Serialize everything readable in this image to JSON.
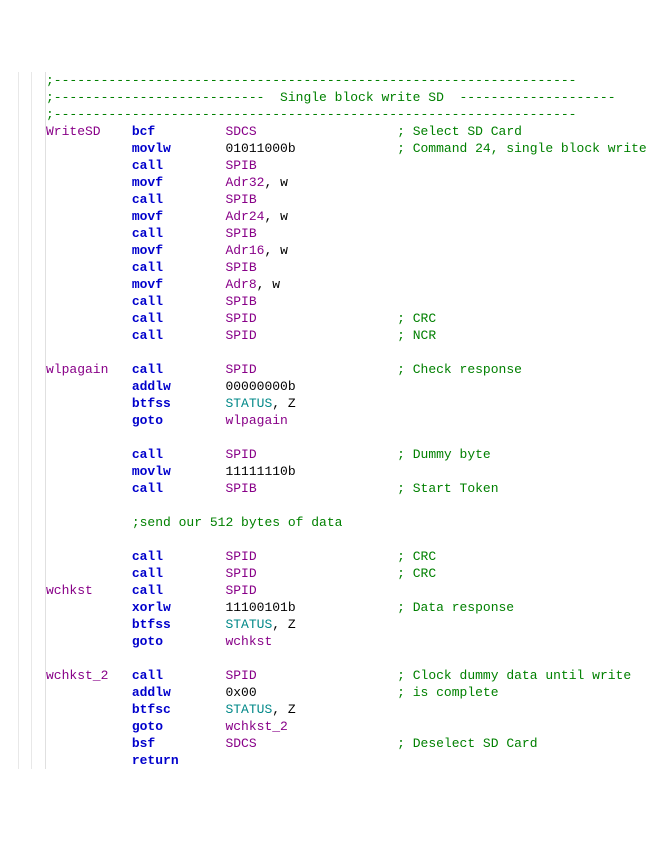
{
  "header": {
    "dashLine": ";-------------------------------------------------------------------",
    "titlePrefix": ";---------------------------  ",
    "title": "Single block write SD",
    "titleSuffix": "  --------------------"
  },
  "columns": {
    "labelWidth": 11,
    "instrWidth": 12,
    "operandWidth": 22
  },
  "lines": [
    {
      "type": "header-dash"
    },
    {
      "type": "header-title"
    },
    {
      "type": "header-dash"
    },
    {
      "type": "code",
      "label": "WriteSD",
      "instr": "bcf",
      "operands": [
        {
          "t": "operand",
          "v": "SDCS"
        }
      ],
      "comment": "; Select SD Card"
    },
    {
      "type": "code",
      "label": "",
      "instr": "movlw",
      "operands": [
        {
          "t": "text",
          "v": "01011000b"
        }
      ],
      "comment": "; Command 24, single block write"
    },
    {
      "type": "code",
      "label": "",
      "instr": "call",
      "operands": [
        {
          "t": "operand",
          "v": "SPIB"
        }
      ],
      "comment": ""
    },
    {
      "type": "code",
      "label": "",
      "instr": "movf",
      "operands": [
        {
          "t": "operand",
          "v": "Adr32"
        },
        {
          "t": "punct",
          "v": ", "
        },
        {
          "t": "text",
          "v": "w"
        }
      ],
      "comment": ""
    },
    {
      "type": "code",
      "label": "",
      "instr": "call",
      "operands": [
        {
          "t": "operand",
          "v": "SPIB"
        }
      ],
      "comment": ""
    },
    {
      "type": "code",
      "label": "",
      "instr": "movf",
      "operands": [
        {
          "t": "operand",
          "v": "Adr24"
        },
        {
          "t": "punct",
          "v": ", "
        },
        {
          "t": "text",
          "v": "w"
        }
      ],
      "comment": ""
    },
    {
      "type": "code",
      "label": "",
      "instr": "call",
      "operands": [
        {
          "t": "operand",
          "v": "SPIB"
        }
      ],
      "comment": ""
    },
    {
      "type": "code",
      "label": "",
      "instr": "movf",
      "operands": [
        {
          "t": "operand",
          "v": "Adr16"
        },
        {
          "t": "punct",
          "v": ", "
        },
        {
          "t": "text",
          "v": "w"
        }
      ],
      "comment": ""
    },
    {
      "type": "code",
      "label": "",
      "instr": "call",
      "operands": [
        {
          "t": "operand",
          "v": "SPIB"
        }
      ],
      "comment": ""
    },
    {
      "type": "code",
      "label": "",
      "instr": "movf",
      "operands": [
        {
          "t": "operand",
          "v": "Adr8"
        },
        {
          "t": "punct",
          "v": ", "
        },
        {
          "t": "text",
          "v": "w"
        }
      ],
      "comment": ""
    },
    {
      "type": "code",
      "label": "",
      "instr": "call",
      "operands": [
        {
          "t": "operand",
          "v": "SPIB"
        }
      ],
      "comment": ""
    },
    {
      "type": "code",
      "label": "",
      "instr": "call",
      "operands": [
        {
          "t": "operand",
          "v": "SPID"
        }
      ],
      "comment": "; CRC"
    },
    {
      "type": "code",
      "label": "",
      "instr": "call",
      "operands": [
        {
          "t": "operand",
          "v": "SPID"
        }
      ],
      "comment": "; NCR"
    },
    {
      "type": "blank"
    },
    {
      "type": "code",
      "label": "wlpagain",
      "instr": "call",
      "operands": [
        {
          "t": "operand",
          "v": "SPID"
        }
      ],
      "comment": "; Check response"
    },
    {
      "type": "code",
      "label": "",
      "instr": "addlw",
      "operands": [
        {
          "t": "text",
          "v": "00000000b"
        }
      ],
      "comment": ""
    },
    {
      "type": "code",
      "label": "",
      "instr": "btfss",
      "operands": [
        {
          "t": "register",
          "v": "STATUS"
        },
        {
          "t": "punct",
          "v": ", "
        },
        {
          "t": "text",
          "v": "Z"
        }
      ],
      "comment": ""
    },
    {
      "type": "code",
      "label": "",
      "instr": "goto",
      "operands": [
        {
          "t": "operand",
          "v": "wlpagain"
        }
      ],
      "comment": ""
    },
    {
      "type": "blank"
    },
    {
      "type": "code",
      "label": "",
      "instr": "call",
      "operands": [
        {
          "t": "operand",
          "v": "SPID"
        }
      ],
      "comment": "; Dummy byte"
    },
    {
      "type": "code",
      "label": "",
      "instr": "movlw",
      "operands": [
        {
          "t": "text",
          "v": "11111110b"
        }
      ],
      "comment": ""
    },
    {
      "type": "code",
      "label": "",
      "instr": "call",
      "operands": [
        {
          "t": "operand",
          "v": "SPIB"
        }
      ],
      "comment": "; Start Token"
    },
    {
      "type": "blank"
    },
    {
      "type": "comment-only",
      "text": ";send our 512 bytes of data"
    },
    {
      "type": "blank"
    },
    {
      "type": "code",
      "label": "",
      "instr": "call",
      "operands": [
        {
          "t": "operand",
          "v": "SPID"
        }
      ],
      "comment": "; CRC"
    },
    {
      "type": "code",
      "label": "",
      "instr": "call",
      "operands": [
        {
          "t": "operand",
          "v": "SPID"
        }
      ],
      "comment": "; CRC"
    },
    {
      "type": "code",
      "label": "wchkst",
      "instr": "call",
      "operands": [
        {
          "t": "operand",
          "v": "SPID"
        }
      ],
      "comment": ""
    },
    {
      "type": "code",
      "label": "",
      "instr": "xorlw",
      "operands": [
        {
          "t": "text",
          "v": "11100101b"
        }
      ],
      "comment": "; Data response"
    },
    {
      "type": "code",
      "label": "",
      "instr": "btfss",
      "operands": [
        {
          "t": "register",
          "v": "STATUS"
        },
        {
          "t": "punct",
          "v": ", "
        },
        {
          "t": "text",
          "v": "Z"
        }
      ],
      "comment": ""
    },
    {
      "type": "code",
      "label": "",
      "instr": "goto",
      "operands": [
        {
          "t": "operand",
          "v": "wchkst"
        }
      ],
      "comment": ""
    },
    {
      "type": "blank"
    },
    {
      "type": "code",
      "label": "wchkst_2",
      "instr": "call",
      "operands": [
        {
          "t": "operand",
          "v": "SPID"
        }
      ],
      "comment": "; Clock dummy data until write"
    },
    {
      "type": "code",
      "label": "",
      "instr": "addlw",
      "operands": [
        {
          "t": "text",
          "v": "0x00"
        }
      ],
      "comment": "; is complete"
    },
    {
      "type": "code",
      "label": "",
      "instr": "btfsc",
      "operands": [
        {
          "t": "register",
          "v": "STATUS"
        },
        {
          "t": "punct",
          "v": ", "
        },
        {
          "t": "text",
          "v": "Z"
        }
      ],
      "comment": ""
    },
    {
      "type": "code",
      "label": "",
      "instr": "goto",
      "operands": [
        {
          "t": "operand",
          "v": "wchkst_2"
        }
      ],
      "comment": ""
    },
    {
      "type": "code",
      "label": "",
      "instr": "bsf",
      "operands": [
        {
          "t": "operand",
          "v": "SDCS"
        }
      ],
      "comment": "; Deselect SD Card"
    },
    {
      "type": "code",
      "label": "",
      "instr": "return",
      "operands": [],
      "comment": ""
    }
  ]
}
